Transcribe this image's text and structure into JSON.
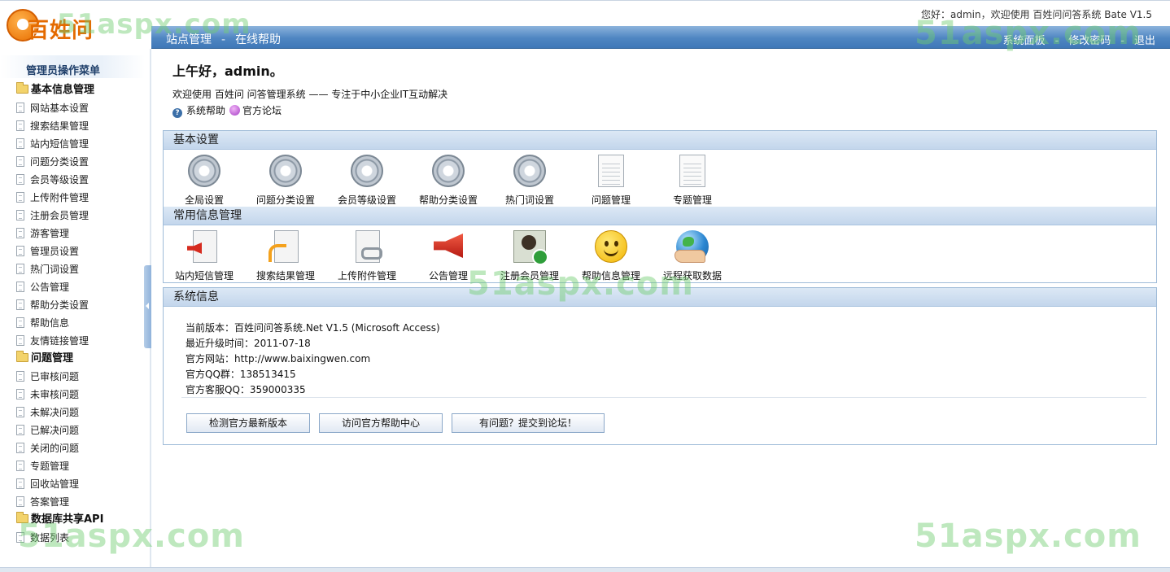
{
  "header": {
    "logo_text": "百姓问",
    "top_right": "您好：admin，欢迎使用 百姓问问答系统 Bate V1.5",
    "nav_left": [
      "站点管理",
      "在线帮助"
    ],
    "nav_separator": "-",
    "nav_right": [
      "系统面板",
      "修改密码",
      "退出"
    ]
  },
  "sidebar": {
    "title": "管理员操作菜单",
    "groups": [
      {
        "label": "基本信息管理",
        "items": [
          "网站基本设置",
          "搜索结果管理",
          "站内短信管理",
          "问题分类设置",
          "会员等级设置",
          "上传附件管理",
          "注册会员管理",
          "游客管理",
          "管理员设置",
          "热门词设置",
          "公告管理",
          "帮助分类设置",
          "帮助信息",
          "友情链接管理"
        ]
      },
      {
        "label": "问题管理",
        "items": [
          "已审核问题",
          "未审核问题",
          "未解决问题",
          "已解决问题",
          "关闭的问题",
          "专题管理",
          "回收站管理",
          "答案管理"
        ]
      },
      {
        "label": "数据库共享API",
        "items": [
          "数据列表"
        ]
      }
    ]
  },
  "main": {
    "greeting": "上午好，admin。",
    "welcome": "欢迎使用 百姓问 问答管理系统 —— 专注于中小企业IT互动解决",
    "help_link": "系统帮助",
    "forum_link": "官方论坛",
    "basic_settings": {
      "title": "基本设置",
      "tiles": [
        {
          "label": "全局设置",
          "icon": "gear-icon"
        },
        {
          "label": "问题分类设置",
          "icon": "gear-icon"
        },
        {
          "label": "会员等级设置",
          "icon": "gear-icon"
        },
        {
          "label": "帮助分类设置",
          "icon": "gear-icon"
        },
        {
          "label": "热门词设置",
          "icon": "gear-icon"
        },
        {
          "label": "问题管理",
          "icon": "document-icon"
        },
        {
          "label": "专题管理",
          "icon": "document-icon"
        }
      ]
    },
    "common_info": {
      "title": "常用信息管理",
      "tiles": [
        {
          "label": "站内短信管理",
          "icon": "document-megaphone-icon"
        },
        {
          "label": "搜索结果管理",
          "icon": "document-rss-icon"
        },
        {
          "label": "上传附件管理",
          "icon": "document-link-icon"
        },
        {
          "label": "公告管理",
          "icon": "megaphone-icon"
        },
        {
          "label": "注册会员管理",
          "icon": "user-check-icon"
        },
        {
          "label": "帮助信息管理",
          "icon": "smiley-icon"
        },
        {
          "label": "远程获取数据",
          "icon": "globe-hand-icon"
        }
      ]
    },
    "system_info": {
      "title": "系统信息",
      "lines": [
        "当前版本：百姓问问答系统.Net V1.5 (Microsoft Access)",
        "最近升级时间：2011-07-18",
        "官方网站：http://www.baixingwen.com",
        "官方QQ群：138513415",
        "官方客服QQ：359000335"
      ],
      "buttons": [
        "检测官方最新版本",
        "访问官方帮助中心",
        "有问题？提交到论坛！"
      ]
    }
  },
  "watermark": "51aspx.com",
  "colors": {
    "nav_bar": "#4f86c2",
    "panel_header": "#c3d6ec",
    "panel_border": "#9fbbd8",
    "logo_orange": "#e46a00",
    "watermark_green": "#6ecd6e"
  }
}
